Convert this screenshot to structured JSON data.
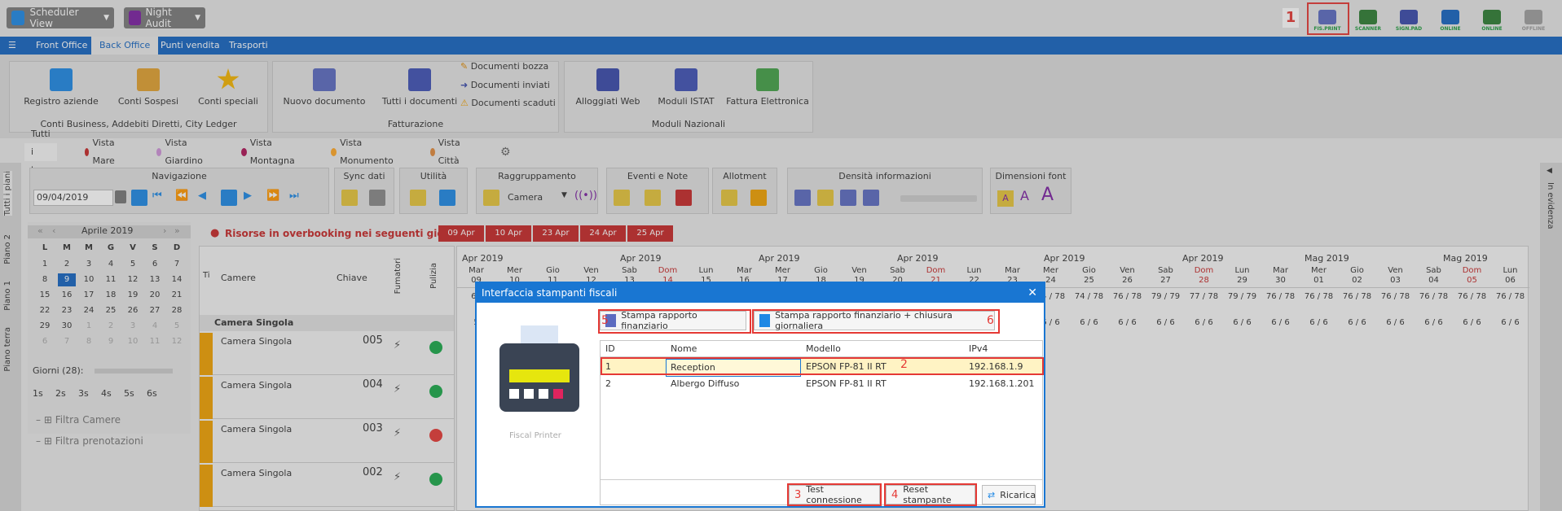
{
  "topbar": {
    "scheduler_view": "Scheduler View",
    "night_audit": "Night Audit",
    "devices": [
      {
        "label": "FIS.PRINT"
      },
      {
        "label": "SCANNER"
      },
      {
        "label": "SIGN.PAD"
      },
      {
        "label": "ONLINE"
      },
      {
        "label": "ONLINE"
      },
      {
        "label": "OFFLINE"
      }
    ]
  },
  "menu": {
    "items": [
      "Front Office",
      "Back Office",
      "Punti vendita",
      "Trasporti"
    ],
    "active": "Back Office"
  },
  "ribbon": {
    "group1": {
      "label": "Conti Business, Addebiti Diretti, City Ledger",
      "buttons": [
        "Registro aziende",
        "Conti Sospesi",
        "Conti speciali"
      ]
    },
    "group2": {
      "label": "Fatturazione",
      "buttons": [
        "Nuovo documento",
        "Tutti i documenti"
      ],
      "small": [
        "Documenti bozza",
        "Documenti inviati",
        "Documenti scaduti"
      ]
    },
    "group3": {
      "label": "Moduli Nazionali",
      "buttons": [
        "Alloggiati Web",
        "Moduli ISTAT",
        "Fattura Elettronica"
      ]
    }
  },
  "tags": [
    {
      "label": "Tutti i tag",
      "color": ""
    },
    {
      "label": "Vista Mare",
      "color": "#c62828"
    },
    {
      "label": "Vista Giardino",
      "color": "#ce93d8"
    },
    {
      "label": "Vista Montagna",
      "color": "#ad1457"
    },
    {
      "label": "Vista Monumento",
      "color": "#ffa726"
    },
    {
      "label": "Vista Città",
      "color": "#e08a3c"
    }
  ],
  "vtabs": [
    "Tutti i piani",
    "Piano 2",
    "Piano 1",
    "Piano terra"
  ],
  "right_tab": "In evidenza",
  "toolbar": {
    "navigazione": "Navigazione",
    "date": "09/04/2019",
    "sync": "Sync dati",
    "utilita": "Utilità",
    "raggruppamento": "Raggruppamento",
    "group_value": "Camera",
    "eventi": "Eventi e Note",
    "allotment": "Allotment",
    "densita": "Densità informazioni",
    "dimensioni": "Dimensioni font",
    "font_a": "A"
  },
  "calendar": {
    "month": "Aprile 2019",
    "weekdays": [
      "L",
      "M",
      "M",
      "G",
      "V",
      "S",
      "D"
    ],
    "rows": [
      [
        "1",
        "2",
        "3",
        "4",
        "5",
        "6",
        "7"
      ],
      [
        "8",
        "9",
        "10",
        "11",
        "12",
        "13",
        "14"
      ],
      [
        "15",
        "16",
        "17",
        "18",
        "19",
        "20",
        "21"
      ],
      [
        "22",
        "23",
        "24",
        "25",
        "26",
        "27",
        "28"
      ],
      [
        "29",
        "30",
        "1",
        "2",
        "3",
        "4",
        "5"
      ],
      [
        "6",
        "7",
        "8",
        "9",
        "10",
        "11",
        "12"
      ]
    ],
    "selected": "9",
    "giorni": "Giorni (28):",
    "speeds": [
      "1s",
      "2s",
      "3s",
      "4s",
      "5s",
      "6s"
    ],
    "filtro_camere": "Filtra Camere",
    "filtro_prenotazioni": "Filtra prenotazioni"
  },
  "overbooking": {
    "text": "Risorse in overbooking nei seguenti giorni:",
    "dates": [
      "09 Apr",
      "10 Apr",
      "23 Apr",
      "24 Apr",
      "25 Apr"
    ]
  },
  "grid": {
    "col_t": "Ti",
    "col_camere": "Camere",
    "col_chiave": "Chiave",
    "col_fumatori": "Fumatori",
    "col_pulizia": "Pulizia",
    "group": "Camera Singola",
    "rooms": [
      {
        "name": "Camera Singola",
        "key": "005",
        "status": "#1aa84a"
      },
      {
        "name": "Camera Singola",
        "key": "004",
        "status": "#1aa84a"
      },
      {
        "name": "Camera Singola",
        "key": "003",
        "status": "#e53935"
      },
      {
        "name": "Camera Singola",
        "key": "002",
        "status": "#1aa84a"
      }
    ],
    "months": [
      "Apr 2019",
      "Apr 2019",
      "Apr 2019",
      "Apr 2019",
      "Apr 2019",
      "Apr 2019",
      "Mag 2019",
      "Mag 2019"
    ],
    "days": [
      {
        "w": "Mar",
        "d": "09"
      },
      {
        "w": "Mer",
        "d": "10"
      },
      {
        "w": "Gio",
        "d": "11"
      },
      {
        "w": "Ven",
        "d": "12"
      },
      {
        "w": "Sab",
        "d": "13"
      },
      {
        "w": "Dom",
        "d": "14",
        "red": true
      },
      {
        "w": "Lun",
        "d": "15"
      },
      {
        "w": "Mar",
        "d": "16"
      },
      {
        "w": "Mer",
        "d": "17"
      },
      {
        "w": "Gio",
        "d": "18"
      },
      {
        "w": "Ven",
        "d": "19"
      },
      {
        "w": "Sab",
        "d": "20"
      },
      {
        "w": "Dom",
        "d": "21",
        "red": true
      },
      {
        "w": "Lun",
        "d": "22"
      },
      {
        "w": "Mar",
        "d": "23"
      },
      {
        "w": "Mer",
        "d": "24"
      },
      {
        "w": "Gio",
        "d": "25"
      },
      {
        "w": "Ven",
        "d": "26"
      },
      {
        "w": "Sab",
        "d": "27"
      },
      {
        "w": "Dom",
        "d": "28",
        "red": true
      },
      {
        "w": "Lun",
        "d": "29"
      },
      {
        "w": "Mar",
        "d": "30"
      },
      {
        "w": "Mer",
        "d": "01"
      },
      {
        "w": "Gio",
        "d": "02"
      },
      {
        "w": "Ven",
        "d": "03"
      },
      {
        "w": "Sab",
        "d": "04"
      },
      {
        "w": "Dom",
        "d": "05",
        "red": true
      },
      {
        "w": "Lun",
        "d": "06"
      }
    ],
    "occ": [
      "65",
      "",
      "",
      "",
      "",
      "",
      "",
      "",
      "",
      "",
      "",
      "",
      "",
      "",
      "",
      "74 / 78",
      "74 / 78",
      "76 / 78",
      "79 / 79",
      "77 / 78",
      "79 / 79",
      "76 / 78",
      "76 / 78",
      "76 / 78",
      "76 / 78",
      "76 / 78",
      "76 / 78",
      "76 / 78"
    ],
    "avail": [
      "5",
      "",
      "",
      "",
      "",
      "",
      "",
      "",
      "",
      "",
      "",
      "",
      "",
      "",
      "",
      "6 / 6",
      "6 / 6",
      "6 / 6",
      "6 / 6",
      "6 / 6",
      "6 / 6",
      "6 / 6",
      "6 / 6",
      "6 / 6",
      "6 / 6",
      "6 / 6",
      "6 / 6",
      "6 / 6"
    ]
  },
  "modal": {
    "title": "Interfaccia stampanti fiscali",
    "printer_caption": "Fiscal Printer",
    "btn_report": "Stampa rapporto finanziario",
    "btn_report_close": "Stampa rapporto finanziario + chiusura giornaliera",
    "columns": [
      "ID",
      "Nome",
      "Modello",
      "IPv4"
    ],
    "rows": [
      {
        "id": "1",
        "nome": "Reception",
        "modello": "EPSON FP-81 II RT",
        "ip": "192.168.1.9"
      },
      {
        "id": "2",
        "nome": "Albergo Diffuso",
        "modello": "EPSON FP-81 II RT",
        "ip": "192.168.1.201"
      }
    ],
    "btn_test": "Test connessione",
    "btn_reset": "Reset stampante",
    "btn_reload": "Ricarica"
  },
  "markers": {
    "n1": "1",
    "n2": "2",
    "n3": "3",
    "n4": "4",
    "n5": "5",
    "n6": "6"
  }
}
